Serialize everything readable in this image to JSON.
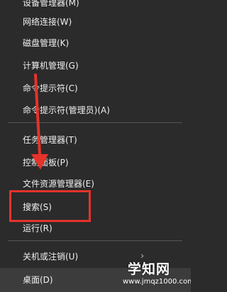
{
  "menu": {
    "items": [
      {
        "label": "设备管理器(M)"
      },
      {
        "label": "网络连接(W)"
      },
      {
        "label": "磁盘管理(K)"
      },
      {
        "label": "计算机管理(G)"
      },
      {
        "label": "命令提示符(C)"
      },
      {
        "label": "命令提示符(管理员)(A)"
      },
      {
        "label": "任务管理器(T)"
      },
      {
        "label": "控制面板(P)"
      },
      {
        "label": "文件资源管理器(E)"
      },
      {
        "label": "搜索(S)"
      },
      {
        "label": "运行(R)"
      },
      {
        "label": "关机或注销(U)",
        "submenu_icon": "chevron-right-icon"
      },
      {
        "label": "桌面(D)"
      }
    ]
  },
  "annotation": {
    "arrow_color": "#e5332a",
    "highlight_color": "#e5332a",
    "highlighted_item": "搜索(S)"
  },
  "watermark": {
    "title": "学知网",
    "url": "www.jmqz1000.com"
  },
  "colors": {
    "background": "#2b2b2b",
    "text": "#f0f0f0",
    "separator": "#555555",
    "selected_background": "#3c3c3c"
  }
}
